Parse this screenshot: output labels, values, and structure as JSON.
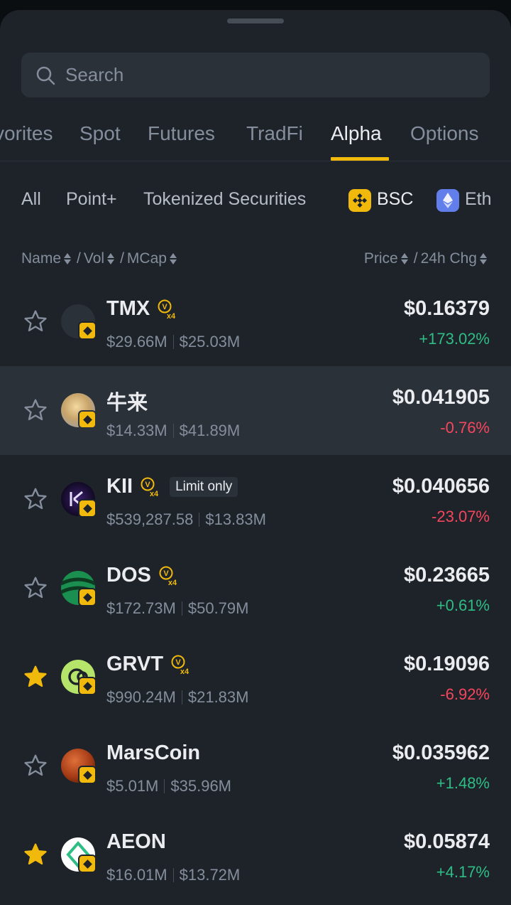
{
  "search": {
    "placeholder": "Search"
  },
  "tabs": [
    "vorites",
    "Spot",
    "Futures",
    "TradFi",
    "Alpha",
    "Options"
  ],
  "active_tab": "Alpha",
  "chips": [
    "All",
    "Point+",
    "Tokenized Securities",
    "BSC",
    "Eth"
  ],
  "selected_chip": "BSC",
  "sort": {
    "name": "Name",
    "vol": "Vol",
    "mcap": "MCap",
    "price": "Price",
    "chg": "24h Chg",
    "slash": "/"
  },
  "badge_text": {
    "v": "V",
    "x4": "x4"
  },
  "colors": {
    "accent": "#f0b90b",
    "up": "#2ebd85",
    "down": "#f6465d",
    "bg": "#1e2329"
  },
  "tokens": [
    {
      "symbol": "TMX",
      "vol": "$29.66M",
      "mcap": "$25.03M",
      "price": "$0.16379",
      "change": "+173.02%",
      "direction": "up",
      "starred": false,
      "x4": true,
      "limit": ""
    },
    {
      "symbol": "牛来",
      "vol": "$14.33M",
      "mcap": "$41.89M",
      "price": "$0.041905",
      "change": "-0.76%",
      "direction": "down",
      "starred": false,
      "x4": false,
      "limit": ""
    },
    {
      "symbol": "KII",
      "vol": "$539,287.58",
      "mcap": "$13.83M",
      "price": "$0.040656",
      "change": "-23.07%",
      "direction": "down",
      "starred": false,
      "x4": true,
      "limit": "Limit only"
    },
    {
      "symbol": "DOS",
      "vol": "$172.73M",
      "mcap": "$50.79M",
      "price": "$0.23665",
      "change": "+0.61%",
      "direction": "up",
      "starred": false,
      "x4": true,
      "limit": ""
    },
    {
      "symbol": "GRVT",
      "vol": "$990.24M",
      "mcap": "$21.83M",
      "price": "$0.19096",
      "change": "-6.92%",
      "direction": "down",
      "starred": true,
      "x4": true,
      "limit": ""
    },
    {
      "symbol": "MarsCoin",
      "vol": "$5.01M",
      "mcap": "$35.96M",
      "price": "$0.035962",
      "change": "+1.48%",
      "direction": "up",
      "starred": false,
      "x4": false,
      "limit": ""
    },
    {
      "symbol": "AEON",
      "vol": "$16.01M",
      "mcap": "$13.72M",
      "price": "$0.05874",
      "change": "+4.17%",
      "direction": "up",
      "starred": true,
      "x4": false,
      "limit": ""
    }
  ]
}
